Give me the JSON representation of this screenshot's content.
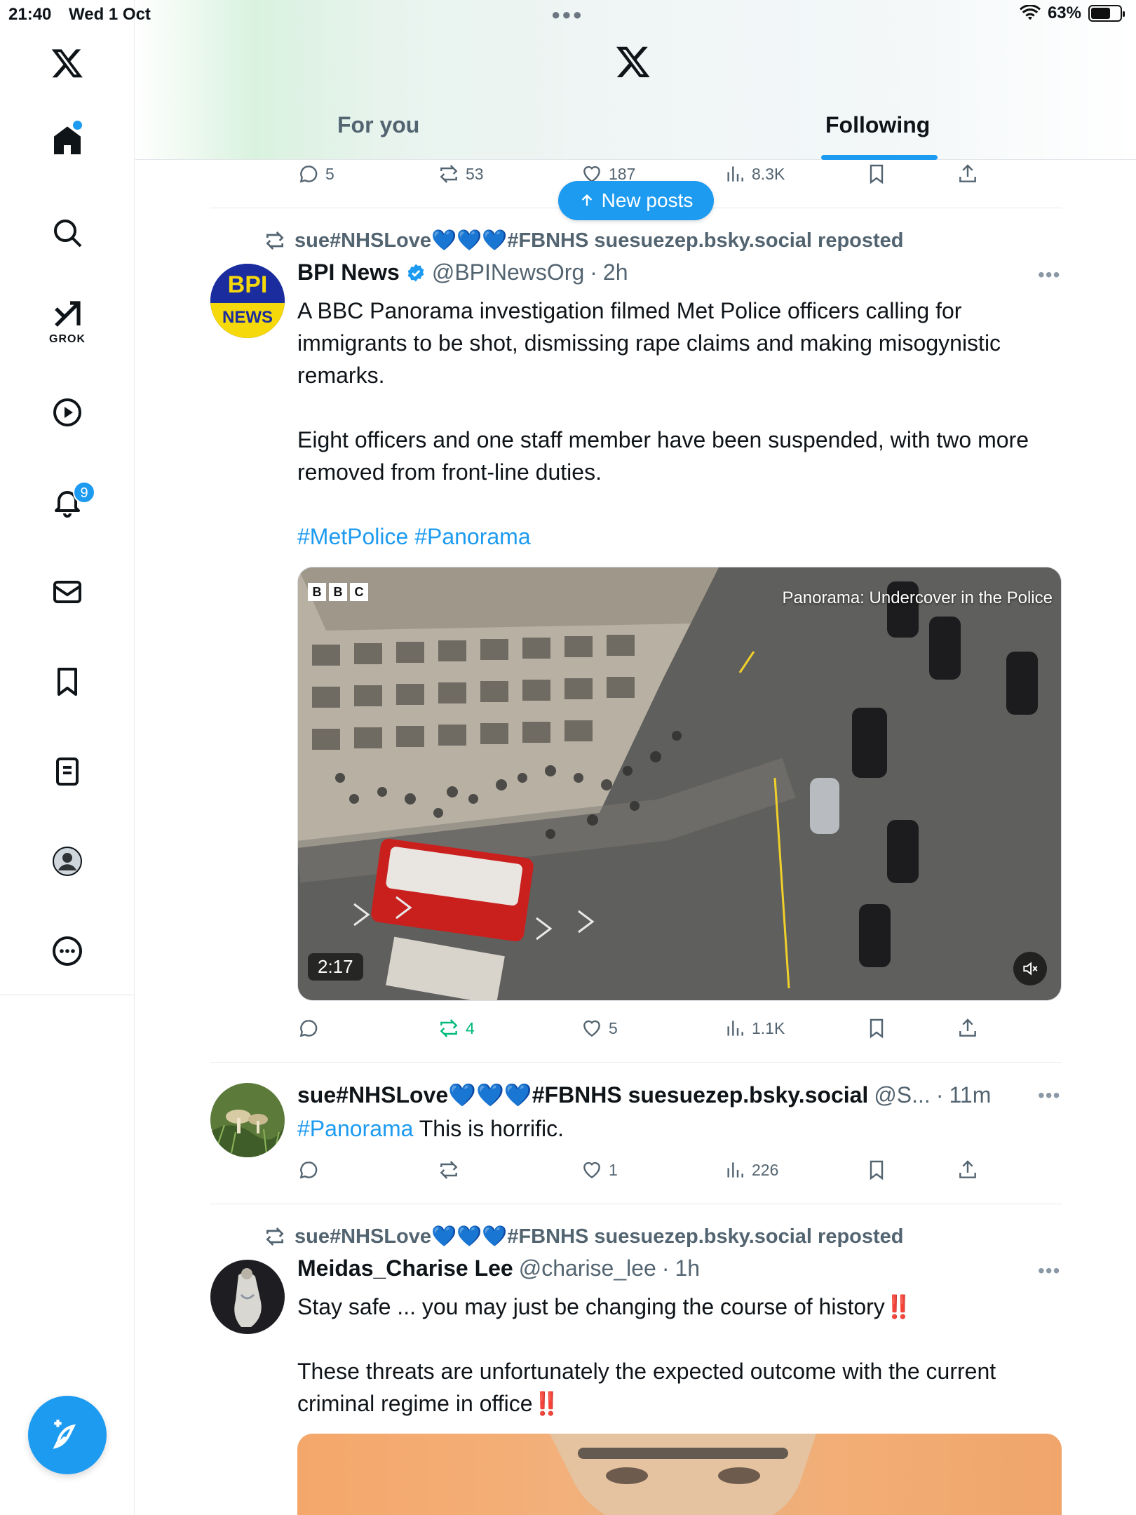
{
  "status_bar": {
    "time": "21:40",
    "date": "Wed 1 Oct",
    "battery": "63%",
    "battery_level": 0.63
  },
  "tabs": {
    "for_you": "For you",
    "following": "Following"
  },
  "sidebar": {
    "grok_label": "GROK",
    "notifications_count": "9"
  },
  "new_posts": "New posts",
  "top_actions": {
    "replies": "5",
    "reposts": "53",
    "likes": "187",
    "views": "8.3K"
  },
  "post1": {
    "repost_by": "sue#NHSLove💙💙💙#FBNHS suesuezep.bsky.social reposted",
    "avatar_line1": "BPI",
    "avatar_line2": "NEWS",
    "name": "BPI News",
    "handle": "@BPINewsOrg",
    "time": "2h",
    "para1": "A BBC Panorama investigation filmed Met Police officers calling for immigrants to be shot, dismissing rape claims and making misogynistic remarks.",
    "para2": "Eight officers and one staff member have been suspended, with two more removed from front-line duties.",
    "hashtags": "#MetPolice #Panorama",
    "video": {
      "brand": [
        "B",
        "B",
        "C"
      ],
      "title": "Panorama: Undercover in the Police",
      "duration": "2:17"
    },
    "actions": {
      "replies": "",
      "reposts": "4",
      "likes": "5",
      "views": "1.1K"
    }
  },
  "post2": {
    "name": "sue#NHSLove💙💙💙#FBNHS suesuezep.bsky.social",
    "handle": "@S...",
    "time": "11m",
    "hashtag": "#Panorama",
    "text": " This is horrific.",
    "actions": {
      "replies": "",
      "reposts": "",
      "likes": "1",
      "views": "226"
    }
  },
  "post3": {
    "repost_by": "sue#NHSLove💙💙💙#FBNHS suesuezep.bsky.social reposted",
    "name": "Meidas_Charise Lee",
    "handle": "@charise_lee",
    "time": "1h",
    "line1": "Stay safe ... you may just be changing the course of history",
    "line2": "These threats are unfortunately the expected outcome with the current criminal regime in office",
    "emphasis": "‼️"
  },
  "colors": {
    "accent": "#1d9bf0",
    "repost_green": "#00ba7c",
    "muted": "#536471"
  }
}
